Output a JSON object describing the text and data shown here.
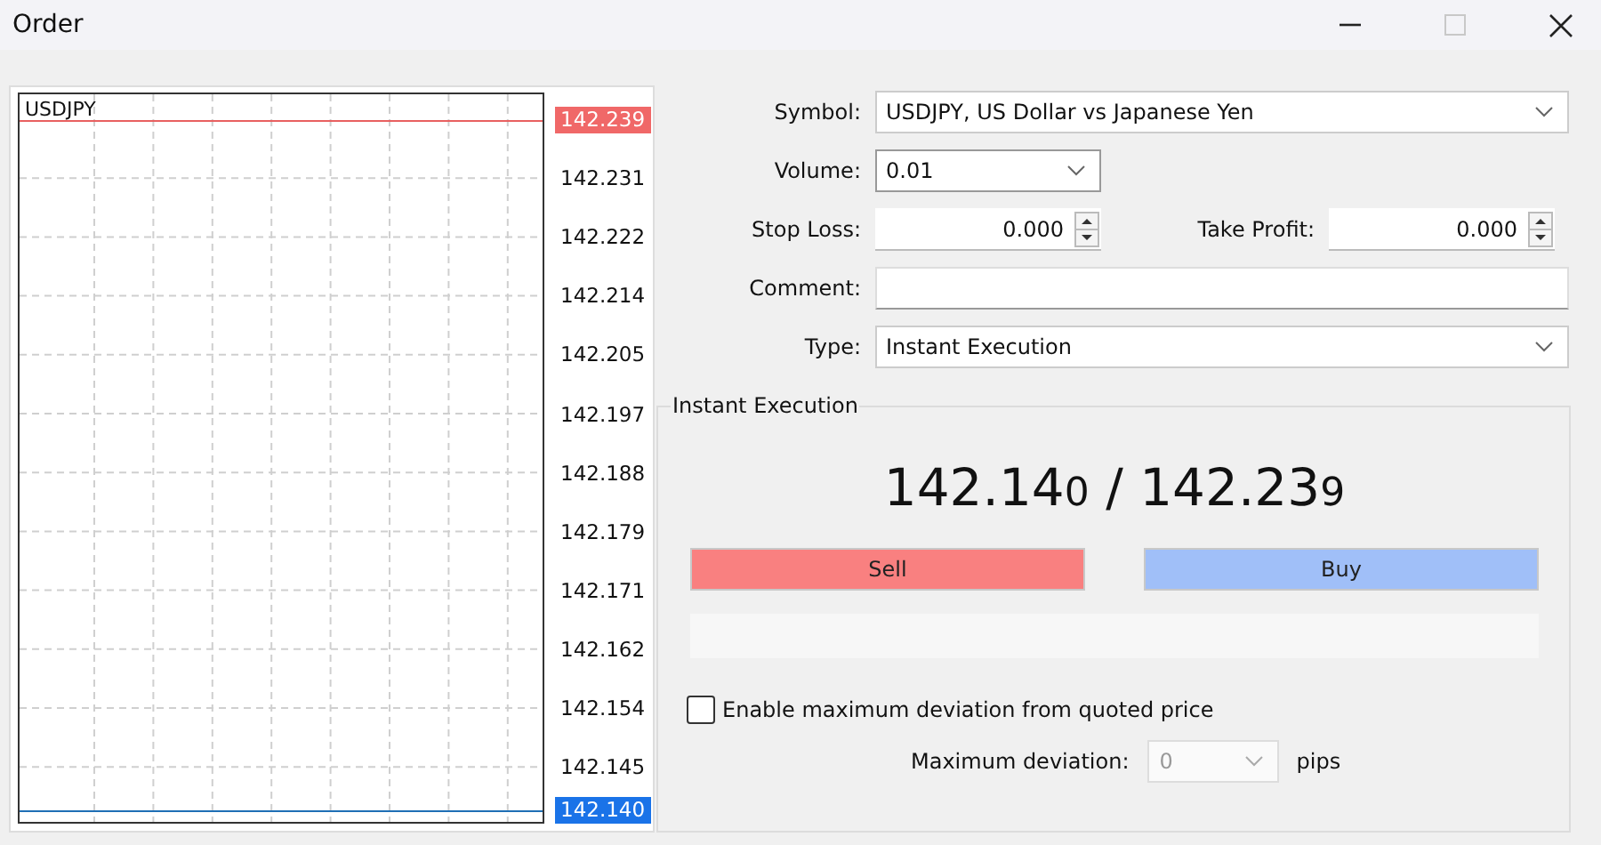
{
  "window": {
    "title": "Order",
    "controls": [
      {
        "kind": "minimize",
        "disabled": false
      },
      {
        "kind": "maximize",
        "disabled": true
      },
      {
        "kind": "close",
        "disabled": false
      }
    ]
  },
  "chart": {
    "symbol": "USDJPY",
    "price_labels": [
      {
        "text": "142.239",
        "kind": "ask"
      },
      {
        "text": "142.231",
        "kind": "tick"
      },
      {
        "text": "142.222",
        "kind": "tick"
      },
      {
        "text": "142.214",
        "kind": "tick"
      },
      {
        "text": "142.205",
        "kind": "tick"
      },
      {
        "text": "142.197",
        "kind": "tick"
      },
      {
        "text": "142.188",
        "kind": "tick"
      },
      {
        "text": "142.179",
        "kind": "tick"
      },
      {
        "text": "142.171",
        "kind": "tick"
      },
      {
        "text": "142.162",
        "kind": "tick"
      },
      {
        "text": "142.154",
        "kind": "tick"
      },
      {
        "text": "142.145",
        "kind": "tick"
      },
      {
        "text": "142.140",
        "kind": "bid"
      }
    ]
  },
  "form": {
    "symbol": {
      "label": "Symbol:",
      "value": "USDJPY, US Dollar vs Japanese Yen"
    },
    "volume": {
      "label": "Volume:",
      "value": "0.01"
    },
    "stop_loss": {
      "label": "Stop Loss:",
      "value": "0.000"
    },
    "take_profit": {
      "label": "Take Profit:",
      "value": "0.000"
    },
    "comment": {
      "label": "Comment:"
    },
    "type": {
      "label": "Type:",
      "value": "Instant Execution"
    }
  },
  "execution": {
    "title": "Instant Execution",
    "bid": {
      "main": "142.14",
      "last_digit": "0"
    },
    "separator": "/",
    "ask": {
      "main": "142.23",
      "last_digit": "9"
    },
    "buttons": [
      {
        "label": "Sell",
        "color": "#f98080"
      },
      {
        "label": "Buy",
        "color": "#a0bff8"
      }
    ],
    "deviation_checkbox": {
      "label": "Enable maximum deviation from quoted price",
      "checked": false
    },
    "max_deviation": {
      "label": "Maximum deviation:",
      "value": "0",
      "disabled": true,
      "unit": "pips"
    }
  }
}
